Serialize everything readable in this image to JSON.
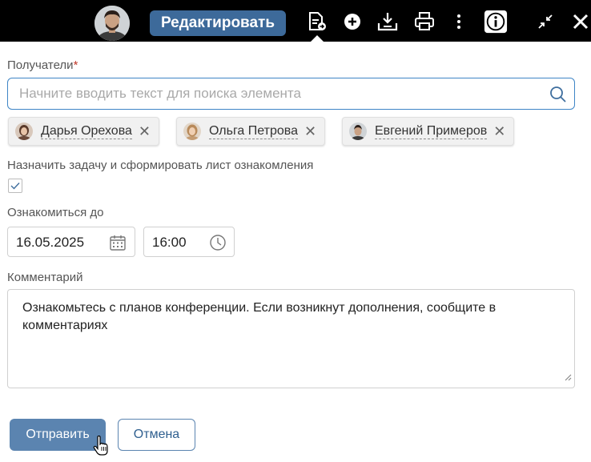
{
  "toolbar": {
    "edit_label": "Редактировать",
    "icons": [
      "user-avatar",
      "document-send-icon",
      "plus-circle-icon",
      "download-tray-icon",
      "printer-icon",
      "kebab-menu-icon",
      "info-icon",
      "collapse-icon",
      "close-icon"
    ]
  },
  "recipients": {
    "label": "Получатели",
    "required_mark": "*",
    "search_placeholder": "Начните вводить текст для поиска элемента",
    "search_value": "",
    "chips": [
      {
        "name": "Дарья Орехова",
        "remove": "✕"
      },
      {
        "name": "Ольга Петрова",
        "remove": "✕"
      },
      {
        "name": "Евгений Примеров",
        "remove": "✕"
      }
    ]
  },
  "task": {
    "label": "Назначить задачу и сформировать лист ознакомления",
    "checked": true
  },
  "deadline": {
    "label": "Ознакомиться до",
    "date": "16.05.2025",
    "time": "16:00"
  },
  "comment": {
    "label": "Комментарий",
    "text": "Ознакомьтесь с планов конференции. Если возникнут дополнения, сообщите в комментариях"
  },
  "actions": {
    "submit_label": "Отправить",
    "cancel_label": "Отмена"
  },
  "colors": {
    "primary": "#5b84b0",
    "edit_button": "#3d6a9a",
    "topbar": "#000000",
    "focus_border": "#3e85c6"
  }
}
